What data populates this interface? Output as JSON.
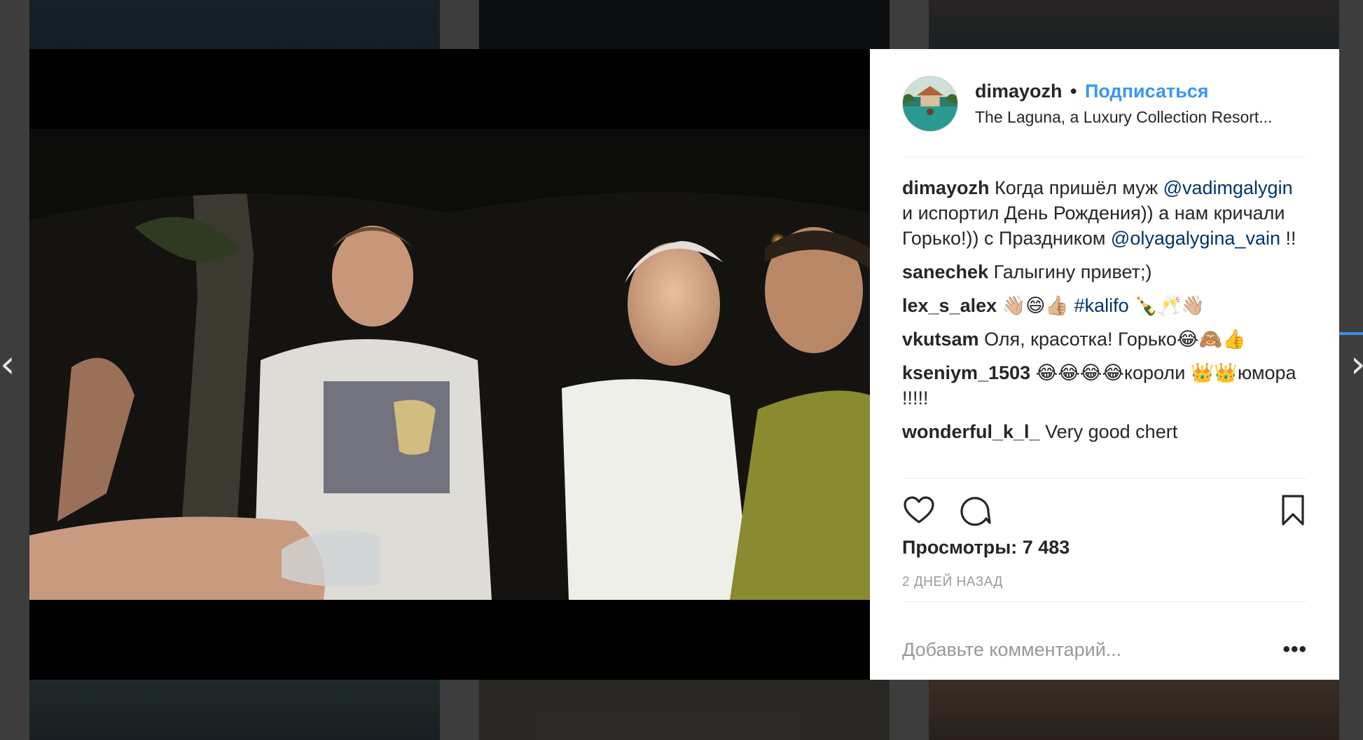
{
  "post": {
    "username": "dimayozh",
    "separator": "•",
    "follow_label": "Подписаться",
    "location": "The Laguna, a Luxury Collection Resort..."
  },
  "caption": {
    "user": "dimayozh",
    "text_1": "Когда пришёл муж ",
    "mention_1": "@vadimgalygin",
    "text_2": " и испортил День Рождения)) а нам кричали Горько!)) с Праздником ",
    "mention_2": "@olyagalygina_vain",
    "text_3": " !!"
  },
  "comments": [
    {
      "user": "sanechek",
      "text": "Галыгину привет;)"
    },
    {
      "user": "lex_s_alex",
      "text_before": "👋🏼😄👍🏼 ",
      "hashtag": "#kalifo",
      "text_after": " 🍾🥂👋🏼"
    },
    {
      "user": "vkutsam",
      "text": "Оля, красотка! Горько😂🙈👍"
    },
    {
      "user": "kseniym_1503",
      "text": "😂😂😂😂короли 👑👑юмора !!!!!"
    },
    {
      "user": "wonderful_k_l_",
      "text": "Very good chert"
    }
  ],
  "stats": {
    "views": "Просмотры: 7 483",
    "time": "2 дней назад"
  },
  "add_comment": {
    "placeholder": "Добавьте комментарий...",
    "more": "•••"
  },
  "nav": {
    "prev": "‹",
    "next": "›"
  },
  "icons": {
    "like": "heart-icon",
    "comment": "comment-bubble-icon",
    "save": "bookmark-icon"
  },
  "colors": {
    "follow": "#3897f0",
    "link": "#003569",
    "text": "#262626",
    "muted": "#999999"
  }
}
